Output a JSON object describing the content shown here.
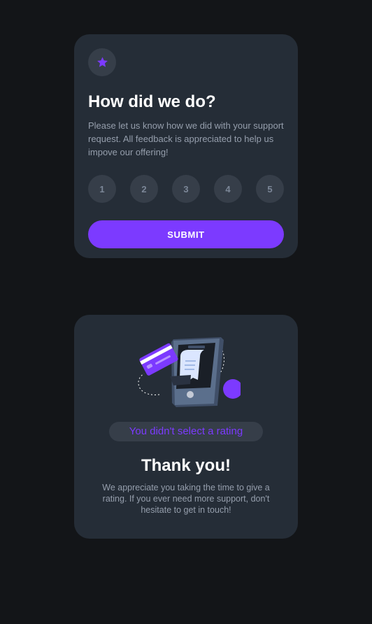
{
  "rating_card": {
    "icon": "star-icon",
    "title": "How did we do?",
    "description": "Please let us know how we did with your support request. All feedback is appreciated to help us impove our offering!",
    "ratings": [
      "1",
      "2",
      "3",
      "4",
      "5"
    ],
    "submit_label": "SUBMIT"
  },
  "thanks_card": {
    "illustration": "payment-phone-illustration",
    "selected_text": "You didn't select a rating",
    "title": "Thank you!",
    "description": "We appreciate you taking the time to give a rating. If you ever need more support, don't hesitate to get in touch!"
  },
  "colors": {
    "background": "#131518",
    "card": "#252d37",
    "accent": "#7c3aff",
    "muted_circle": "#363e49",
    "text_muted": "#959eac"
  }
}
